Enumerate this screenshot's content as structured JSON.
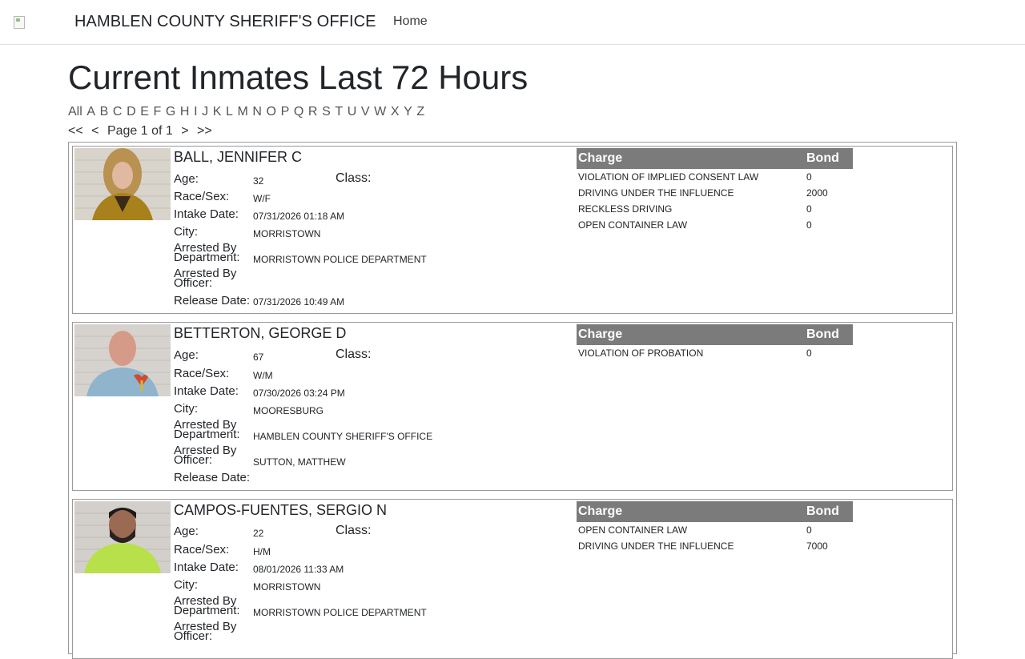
{
  "nav": {
    "brand": "HAMBLEN COUNTY SHERIFF'S OFFICE",
    "home": "Home"
  },
  "page_title": "Current Inmates Last 72 Hours",
  "letters": [
    "All",
    "A",
    "B",
    "C",
    "D",
    "E",
    "F",
    "G",
    "H",
    "I",
    "J",
    "K",
    "L",
    "M",
    "N",
    "O",
    "P",
    "Q",
    "R",
    "S",
    "T",
    "U",
    "V",
    "W",
    "X",
    "Y",
    "Z"
  ],
  "pager": {
    "first": "<<",
    "prev": "<",
    "status": "Page 1 of 1",
    "next": ">",
    "last": ">>"
  },
  "labels": {
    "age": "Age:",
    "class": "Class:",
    "race_sex": "Race/Sex:",
    "intake": "Intake Date:",
    "city": "City:",
    "arrested_by": "Arrested By",
    "department": "Department:",
    "officer": "Officer:",
    "release": "Release Date:",
    "charge": "Charge",
    "bond": "Bond"
  },
  "inmates": [
    {
      "name": "BALL, JENNIFER C",
      "age": "32",
      "class": "",
      "race_sex": "W/F",
      "intake": "07/31/2026 01:18 AM",
      "city": "MORRISTOWN",
      "department": "MORRISTOWN POLICE DEPARTMENT",
      "officer": "",
      "release": "07/31/2026 10:49 AM",
      "charges": [
        {
          "charge": "VIOLATION OF IMPLIED CONSENT LAW",
          "bond": "0"
        },
        {
          "charge": "DRIVING UNDER THE INFLUENCE",
          "bond": "2000"
        },
        {
          "charge": "RECKLESS DRIVING",
          "bond": "0"
        },
        {
          "charge": "OPEN CONTAINER LAW",
          "bond": "0"
        }
      ]
    },
    {
      "name": "BETTERTON, GEORGE D",
      "age": "67",
      "class": "",
      "race_sex": "W/M",
      "intake": "07/30/2026 03:24 PM",
      "city": "MOORESBURG",
      "department": "HAMBLEN COUNTY SHERIFF'S OFFICE",
      "officer": "SUTTON, MATTHEW",
      "release": "",
      "charges": [
        {
          "charge": "VIOLATION OF PROBATION",
          "bond": "0"
        }
      ]
    },
    {
      "name": "CAMPOS-FUENTES, SERGIO N",
      "age": "22",
      "class": "",
      "race_sex": "H/M",
      "intake": "08/01/2026 11:33 AM",
      "city": "MORRISTOWN",
      "department": "MORRISTOWN POLICE DEPARTMENT",
      "officer": "",
      "release": "",
      "charges": [
        {
          "charge": "OPEN CONTAINER LAW",
          "bond": "0"
        },
        {
          "charge": "DRIVING UNDER THE INFLUENCE",
          "bond": "7000"
        }
      ]
    }
  ]
}
